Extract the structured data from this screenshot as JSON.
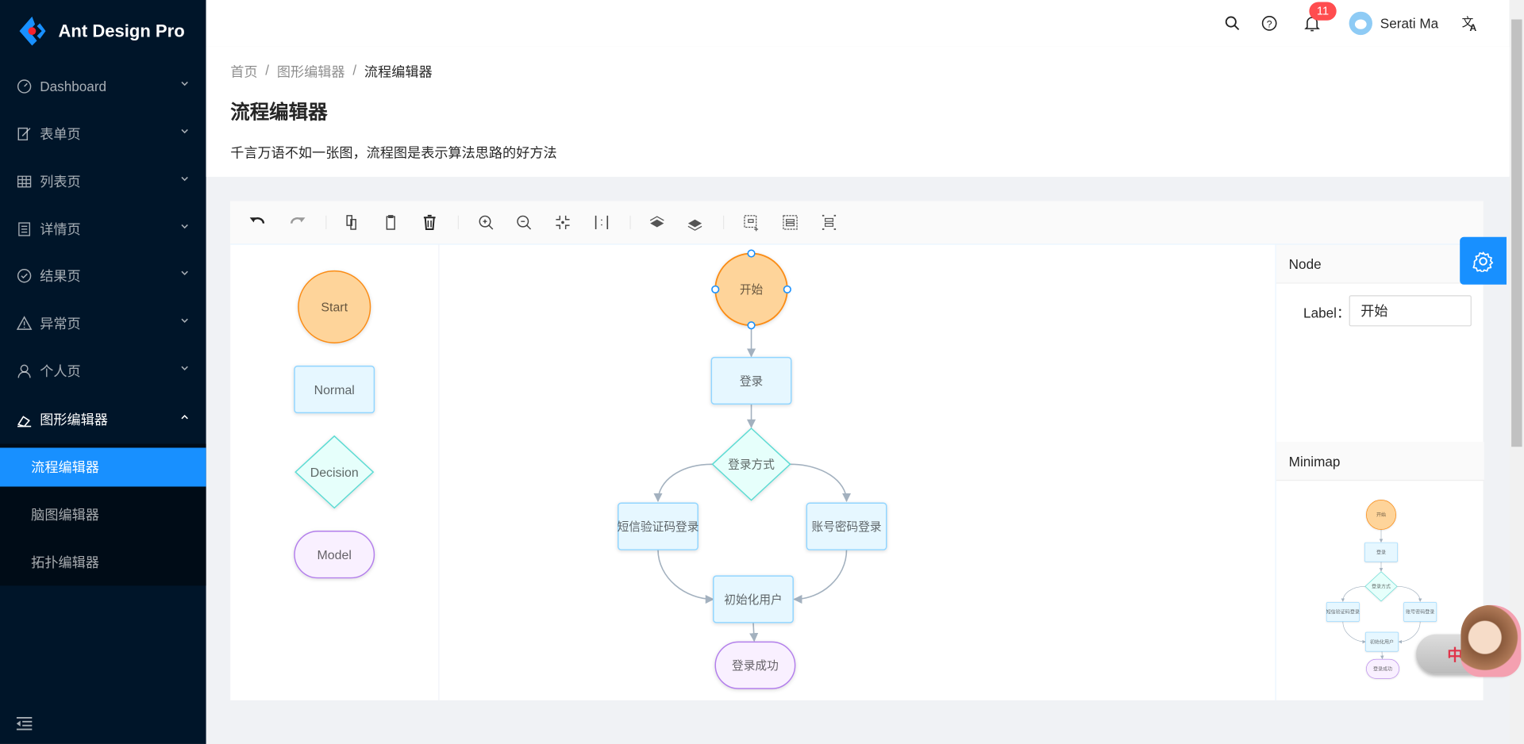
{
  "app": {
    "title": "Ant Design Pro"
  },
  "sidebar": {
    "items": [
      {
        "label": "Dashboard",
        "icon": "dashboard-icon"
      },
      {
        "label": "表单页",
        "icon": "form-icon"
      },
      {
        "label": "列表页",
        "icon": "table-icon"
      },
      {
        "label": "详情页",
        "icon": "profile-icon"
      },
      {
        "label": "结果页",
        "icon": "check-circle-icon"
      },
      {
        "label": "异常页",
        "icon": "warning-icon"
      },
      {
        "label": "个人页",
        "icon": "user-icon"
      },
      {
        "label": "图形编辑器",
        "icon": "highlight-icon",
        "open": true
      }
    ],
    "subitems": [
      {
        "label": "流程编辑器",
        "selected": true
      },
      {
        "label": "脑图编辑器"
      },
      {
        "label": "拓扑编辑器"
      }
    ],
    "accent": "#1890ff",
    "background": "#001529"
  },
  "header": {
    "notification_count": "11",
    "user_name": "Serati Ma"
  },
  "breadcrumb": [
    "首页",
    "图形编辑器",
    "流程编辑器"
  ],
  "page": {
    "title": "流程编辑器",
    "description": "千言万语不如一张图，流程图是表示算法思路的好方法"
  },
  "toolbar": [
    "undo-icon",
    "redo-icon",
    "copy-icon",
    "paste-icon",
    "delete-icon",
    "zoom-in-icon",
    "zoom-out-icon",
    "fit-view-icon",
    "actual-size-icon",
    "to-back-icon",
    "to-front-icon",
    "multi-select-icon",
    "group-icon",
    "ungroup-icon"
  ],
  "item_panel": [
    {
      "label": "Start",
      "shape": "circle"
    },
    {
      "label": "Normal",
      "shape": "rect"
    },
    {
      "label": "Decision",
      "shape": "diamond"
    },
    {
      "label": "Model",
      "shape": "pill"
    }
  ],
  "flow": {
    "nodes": [
      {
        "id": "start",
        "label": "开始",
        "shape": "circle",
        "selected": true
      },
      {
        "id": "login",
        "label": "登录",
        "shape": "rect"
      },
      {
        "id": "method",
        "label": "登录方式",
        "shape": "diamond"
      },
      {
        "id": "sms",
        "label": "短信验证码登录",
        "shape": "rect"
      },
      {
        "id": "account",
        "label": "账号密码登录",
        "shape": "rect"
      },
      {
        "id": "init",
        "label": "初始化用户",
        "shape": "rect"
      },
      {
        "id": "success",
        "label": "登录成功",
        "shape": "pill"
      }
    ],
    "edges": [
      {
        "source": "start",
        "target": "login"
      },
      {
        "source": "login",
        "target": "method"
      },
      {
        "source": "method",
        "target": "sms"
      },
      {
        "source": "method",
        "target": "account"
      },
      {
        "source": "sms",
        "target": "init"
      },
      {
        "source": "account",
        "target": "init"
      },
      {
        "source": "init",
        "target": "success"
      }
    ]
  },
  "detail_panel": {
    "title": "Node",
    "label_caption": "Label：",
    "label_value": "开始"
  },
  "minimap": {
    "title": "Minimap"
  },
  "widget": {
    "text": "中"
  },
  "colors": {
    "start_fill": "#fed49a",
    "start_stroke": "#fa8c16",
    "rect_fill": "#e6f7ff",
    "rect_stroke": "#91d5ff",
    "diamond_fill": "#e6fffb",
    "diamond_stroke": "#5cdbd3",
    "pill_fill": "#f9f0ff",
    "pill_stroke": "#b37feb",
    "edge": "#a3b1bf"
  }
}
